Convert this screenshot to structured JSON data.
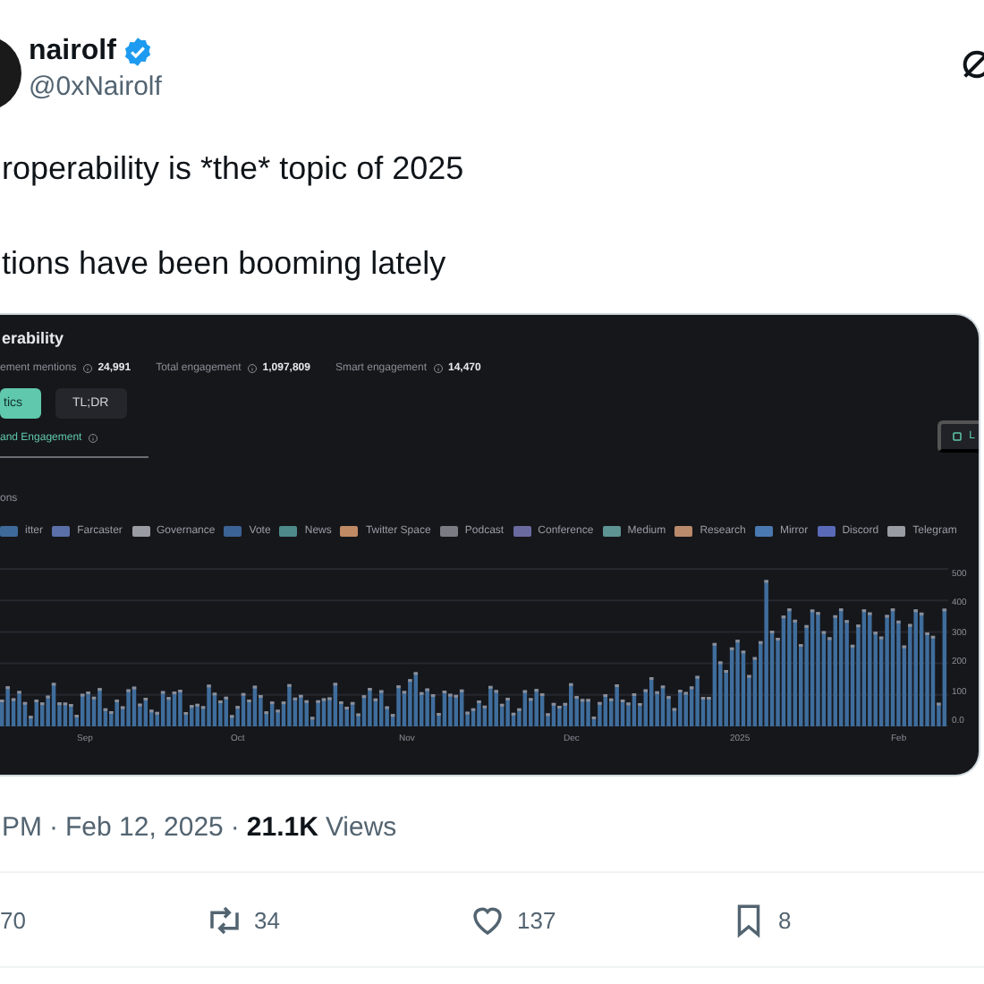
{
  "tweet": {
    "author": {
      "name": "nairolf",
      "handle": "@0xNairolf",
      "verified": true
    },
    "text": [
      "roperability is *the* topic of 2025",
      "tions have been booming lately"
    ],
    "image": {
      "title": "erability",
      "stats": [
        {
          "label": "ement mentions",
          "value": "24,991"
        },
        {
          "label": "Total engagement",
          "value": "1,097,809"
        },
        {
          "label": "Smart engagement",
          "value": "14,470"
        }
      ],
      "tabs": [
        {
          "label": "tics",
          "selected": true
        },
        {
          "label": "TL;DR",
          "selected": false
        }
      ],
      "section_tab": "and Engagement",
      "side_button": "L",
      "legend_title": "ons",
      "legend": [
        {
          "label": "itter",
          "color": "#3d6a99"
        },
        {
          "label": "Farcaster",
          "color": "#5b6fa8"
        },
        {
          "label": "Governance",
          "color": "#9a9ca3"
        },
        {
          "label": "Vote",
          "color": "#3b6395"
        },
        {
          "label": "News",
          "color": "#4e8a8a"
        },
        {
          "label": "Twitter Space",
          "color": "#c08a64"
        },
        {
          "label": "Podcast",
          "color": "#7b7b84"
        },
        {
          "label": "Conference",
          "color": "#6a6aa0"
        },
        {
          "label": "Medium",
          "color": "#5e9494"
        },
        {
          "label": "Research",
          "color": "#b98a6c"
        },
        {
          "label": "Mirror",
          "color": "#4a78b0"
        },
        {
          "label": "Discord",
          "color": "#5a6ab8"
        },
        {
          "label": "Telegram",
          "color": "#9a9ca3"
        }
      ],
      "y_labels": [
        "500",
        "400",
        "300",
        "200",
        "100",
        "0.0"
      ],
      "x_labels": [
        "Sep",
        "Oct",
        "Nov",
        "Dec",
        "2025",
        "Feb"
      ]
    },
    "meta": [
      {
        "kind": "time",
        "text": "PM"
      },
      {
        "kind": "separator",
        "text": "·"
      },
      {
        "kind": "date",
        "text": "Feb 12, 2025"
      },
      {
        "kind": "separator",
        "text": "·"
      },
      {
        "kind": "views_count",
        "text": "21.1K"
      },
      {
        "kind": "views_label",
        "text": "Views"
      }
    ],
    "actions": [
      {
        "kind": "reply",
        "count": "70"
      },
      {
        "kind": "repost",
        "count": "34"
      },
      {
        "kind": "like",
        "count": "137"
      },
      {
        "kind": "bookmark",
        "count": "8"
      }
    ]
  }
}
